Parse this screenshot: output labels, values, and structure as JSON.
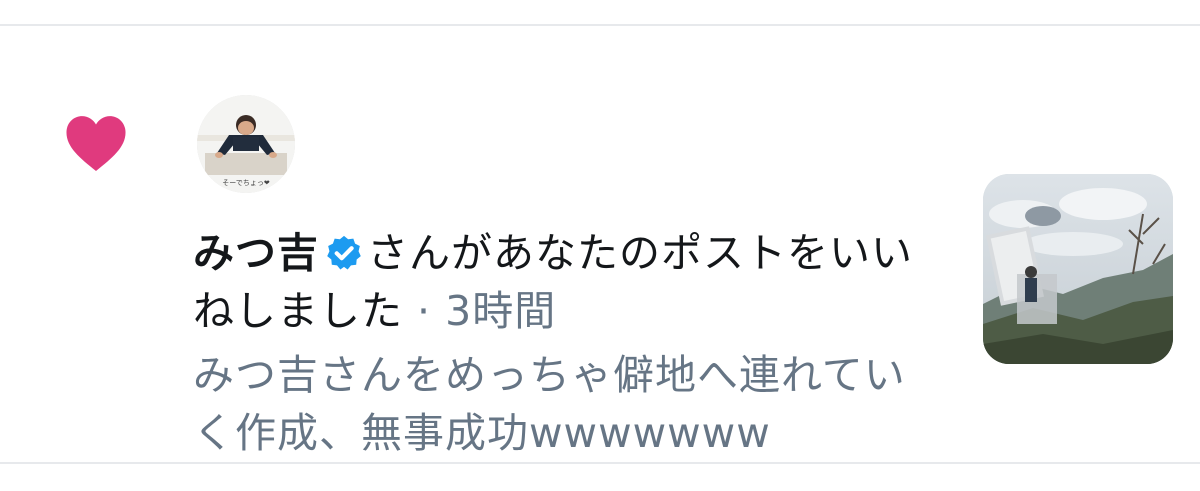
{
  "notification": {
    "user_name": "みつ吉",
    "action_text": "さんがあなたのポストをいいねしました",
    "separator": " · ",
    "time": "3時間",
    "tweet_text": "みつ吉さんをめっちゃ僻地へ連れていく作成、無事成功wwwwwww",
    "avatar_caption": "そーでちょっ❤"
  },
  "icons": {
    "like": "heart-icon",
    "verified": "verified-badge-icon"
  },
  "colors": {
    "like_pink": "#e0245e",
    "verified_blue": "#1d9bf0",
    "primary_text": "#14171a",
    "secondary_text": "#667585",
    "divider": "#e7e9ec"
  }
}
